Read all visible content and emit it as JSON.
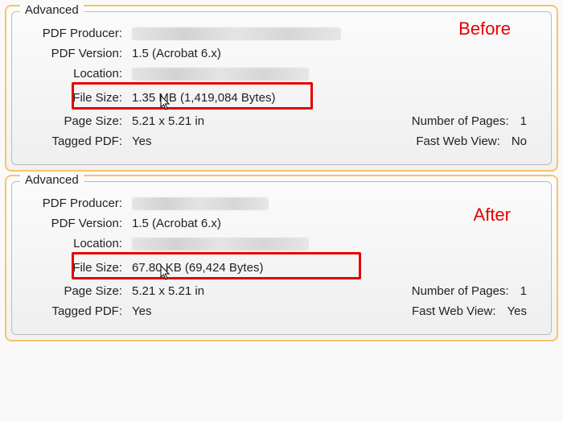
{
  "labels": {
    "section_title": "Advanced",
    "pdf_producer": "PDF Producer:",
    "pdf_version": "PDF Version:",
    "location": "Location:",
    "file_size": "File Size:",
    "page_size": "Page Size:",
    "tagged_pdf": "Tagged PDF:",
    "num_pages": "Number of Pages:",
    "fast_web_view": "Fast Web View:"
  },
  "before": {
    "caption": "Before",
    "pdf_version": "1.5 (Acrobat 6.x)",
    "file_size": "1.35 MB (1,419,084 Bytes)",
    "page_size": "5.21 x 5.21 in",
    "tagged_pdf": "Yes",
    "num_pages": "1",
    "fast_web_view": "No"
  },
  "after": {
    "caption": "After",
    "pdf_version": "1.5 (Acrobat 6.x)",
    "file_size": "67.80 KB (69,424 Bytes)",
    "page_size": "5.21 x 5.21 in",
    "tagged_pdf": "Yes",
    "num_pages": "1",
    "fast_web_view": "Yes"
  }
}
